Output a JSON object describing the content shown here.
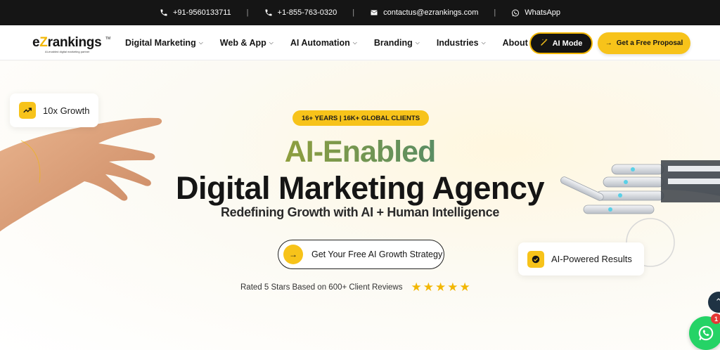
{
  "topbar": {
    "phone_india": "+91-9560133711",
    "phone_us": "+1-855-763-0320",
    "email": "contactus@ezrankings.com",
    "whatsapp": "WhatsApp",
    "separator": "|"
  },
  "logo": {
    "text_prefix": "e",
    "text_v": "Z",
    "text_suffix": "rankings",
    "tm": "TM",
    "tagline": "AI-enabled digital marketing partner"
  },
  "nav": {
    "items": [
      {
        "label": "Digital Marketing"
      },
      {
        "label": "Web & App"
      },
      {
        "label": "AI Automation"
      },
      {
        "label": "Branding"
      },
      {
        "label": "Industries"
      },
      {
        "label": "About"
      }
    ],
    "ai_mode_label": "AI Mode",
    "proposal_label": "Get a Free Proposal"
  },
  "hero": {
    "growth_badge": "10x Growth",
    "years_pill": "16+ YEARS | 16K+ GLOBAL CLIENTS",
    "title_ai": "AI-Enabled",
    "title_main": "Digital Marketing Agency",
    "subtitle": "Redefining Growth with AI + Human Intelligence",
    "cta_label": "Get Your Free AI Growth Strategy",
    "rating_text": "Rated 5 Stars Based on 600+ Client Reviews",
    "stars": 5,
    "ai_badge": "AI-Powered Results"
  },
  "floating": {
    "whatsapp_unread": "1"
  },
  "colors": {
    "accent_yellow": "#f7c31a",
    "dark": "#141414",
    "whatsapp_green": "#25d366"
  }
}
